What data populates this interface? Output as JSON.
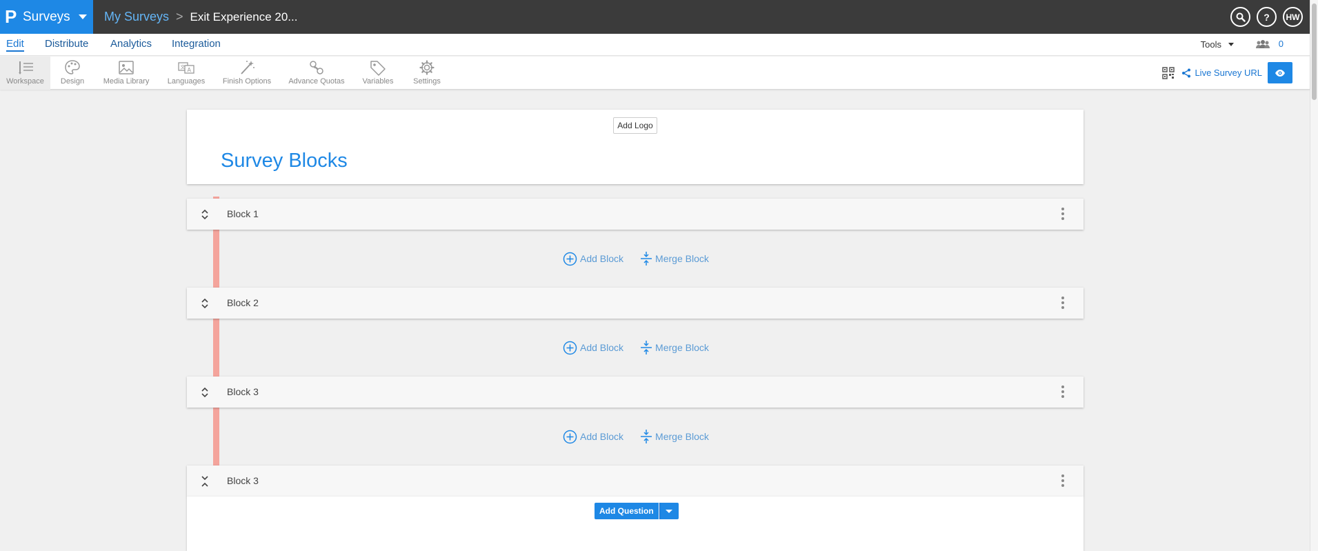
{
  "app": {
    "logo": "P",
    "name": "Surveys",
    "breadcrumb": {
      "parent": "My Surveys",
      "separator": ">",
      "current": "Exit Experience 20..."
    },
    "user_initials": "HW"
  },
  "menu": {
    "items": [
      {
        "label": "Edit",
        "active": true
      },
      {
        "label": "Distribute"
      },
      {
        "label": "Analytics"
      },
      {
        "label": "Integration"
      }
    ],
    "tools_label": "Tools",
    "collaborators_count": "0"
  },
  "toolbar": {
    "items": [
      {
        "label": "Workspace",
        "icon": "workspace-icon"
      },
      {
        "label": "Design",
        "icon": "palette-icon"
      },
      {
        "label": "Media Library",
        "icon": "image-icon"
      },
      {
        "label": "Languages",
        "icon": "translate-icon"
      },
      {
        "label": "Finish Options",
        "icon": "magic-wand-icon"
      },
      {
        "label": "Advance Quotas",
        "icon": "quota-icon"
      },
      {
        "label": "Variables",
        "icon": "tag-icon"
      },
      {
        "label": "Settings",
        "icon": "gear-icon"
      }
    ],
    "live_url_label": "Live Survey URL"
  },
  "survey": {
    "add_logo_label": "Add Logo",
    "title": "Survey Blocks",
    "blocks": [
      {
        "label": "Block 1"
      },
      {
        "label": "Block 2"
      },
      {
        "label": "Block 3"
      },
      {
        "label": "Block 3"
      }
    ],
    "add_block_label": "Add Block",
    "merge_block_label": "Merge Block",
    "add_question_label": "Add Question"
  },
  "colors": {
    "accent": "#1e88e5",
    "topbar": "#3b3b3b",
    "drag_indicator": "#f4a49c"
  }
}
